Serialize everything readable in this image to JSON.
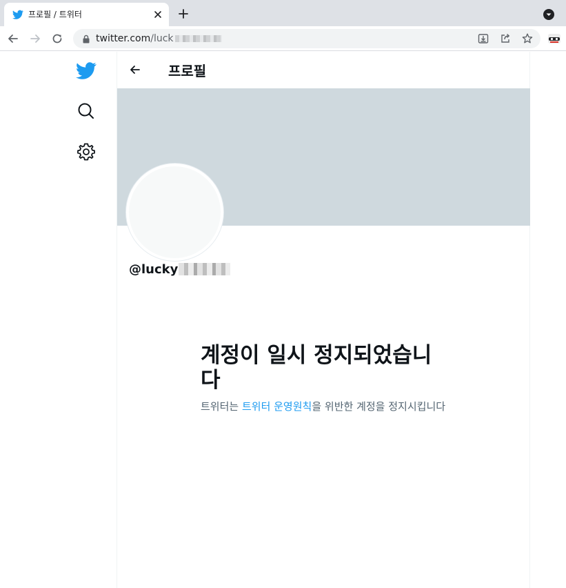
{
  "browser": {
    "tab_title": "프로필 / 트위터",
    "url_host": "twitter.com",
    "url_path": "/luck"
  },
  "page": {
    "header_title": "프로필",
    "handle_prefix": "@lucky",
    "suspension": {
      "title": "계정이 일시 정지되었습니다",
      "body_prefix": "트위터는 ",
      "link_text": "트위터 운영원칙",
      "body_suffix": "을 위반한 계정을 정지시킵니다"
    }
  },
  "icons": {
    "tab_favicon": "twitter-bird-icon",
    "tab_close": "close-icon",
    "new_tab": "plus-icon",
    "tab_search": "chevron-down-circle-icon",
    "back": "arrow-left-icon",
    "forward": "arrow-right-icon",
    "reload": "reload-icon",
    "lock": "lock-icon",
    "install": "install-icon",
    "share": "share-icon",
    "bookmark": "star-icon",
    "extension": "incognito-extension-icon",
    "twitter_logo": "twitter-bird-icon",
    "explore": "search-icon",
    "settings": "gear-icon",
    "profile_back": "arrow-left-icon"
  },
  "colors": {
    "twitter_blue": "#1d9bf0",
    "banner": "#cfd9de",
    "chrome_bar": "#dee1e6",
    "text_primary": "#0f1419",
    "text_secondary": "#536471"
  }
}
